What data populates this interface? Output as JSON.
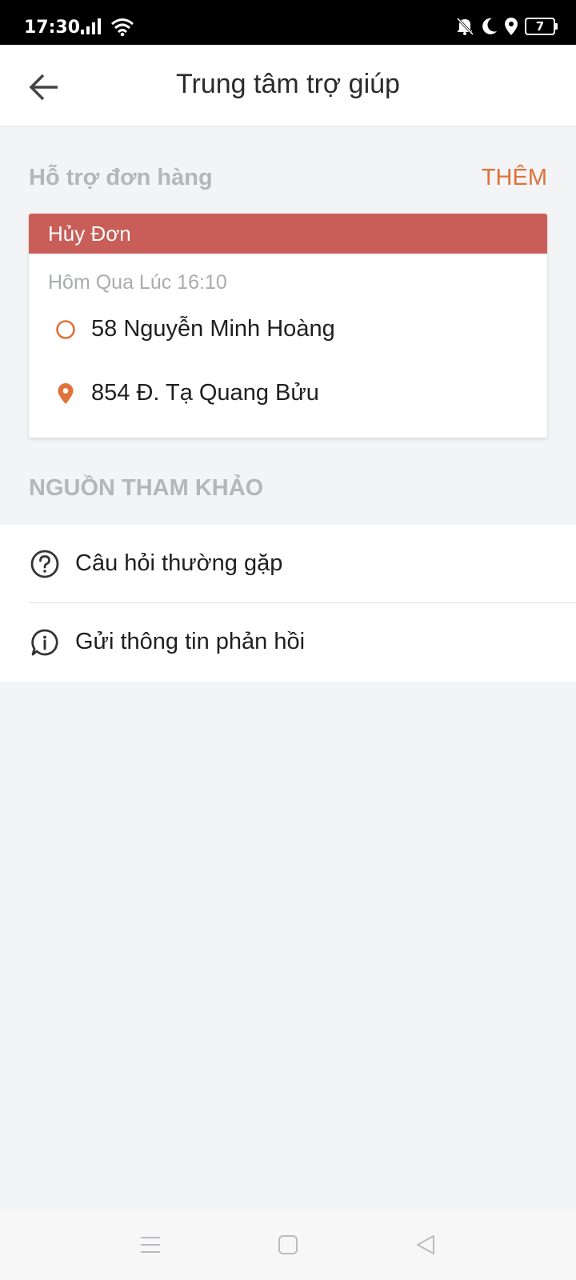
{
  "status_bar": {
    "time": "17:30",
    "battery_level": "7",
    "icons": [
      "signal-icon",
      "wifi-icon",
      "notifications-off-icon",
      "moon-icon",
      "location-icon",
      "battery-icon"
    ]
  },
  "app_bar": {
    "title": "Trung tâm trợ giúp",
    "back_icon": "arrow-left-icon"
  },
  "order_support": {
    "title": "Hỗ trợ đơn hàng",
    "more_label": "THÊM",
    "order": {
      "status": "Hủy Đơn",
      "status_color": "#c95d58",
      "time": "Hôm Qua Lúc 16:10",
      "pickup": "58 Nguyễn Minh Hoàng",
      "dropoff": "854 Đ. Tạ Quang Bửu"
    }
  },
  "references": {
    "title": "NGUỒN THAM KHẢO",
    "items": [
      {
        "label": "Câu hỏi thường gặp",
        "icon": "question-circle-icon"
      },
      {
        "label": "Gửi thông tin phản hồi",
        "icon": "info-chat-icon"
      }
    ]
  },
  "colors": {
    "accent": "#e0723a",
    "cancel": "#c95d58",
    "muted_text": "#b4b6b9",
    "background": "#f3f4f6"
  },
  "nav_bar": {
    "icons": [
      "menu-icon",
      "home-square-icon",
      "back-triangle-icon"
    ]
  }
}
